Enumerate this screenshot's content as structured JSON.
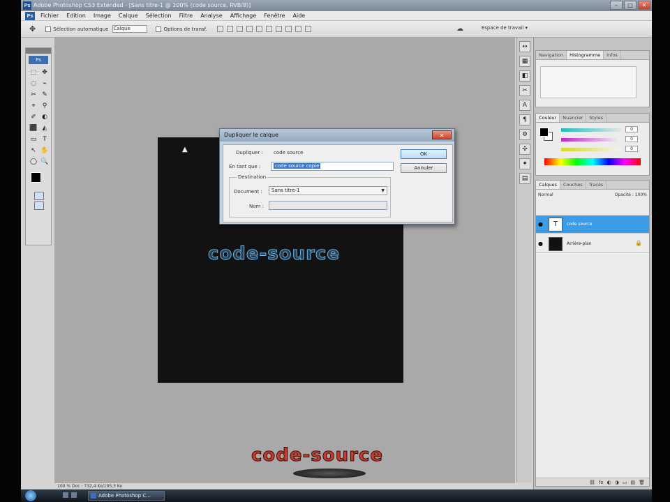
{
  "window": {
    "title": "Adobe Photoshop CS3 Extended - [Sans titre-1 @ 100% (code source, RVB/8)]",
    "app_icon": "Ps",
    "controls": [
      "–",
      "□",
      "✕"
    ]
  },
  "menu": {
    "items": [
      "Fichier",
      "Edition",
      "Image",
      "Calque",
      "Sélection",
      "Filtre",
      "Analyse",
      "Affichage",
      "Fenêtre",
      "Aide"
    ]
  },
  "options_bar": {
    "tool_icon": "move-tool-icon",
    "auto_select_label": "Sélection automatique",
    "auto_select_combo": "Calque",
    "transform_label": "Options de transf.",
    "workspace_label": "Espace de travail ▾"
  },
  "toolbox": {
    "badge": "Ps",
    "tools": [
      "⬚",
      "✥",
      "◌",
      "⌁",
      "✂",
      "✎",
      "⌖",
      "⚲",
      "✐",
      "◐",
      "⬛",
      "◭",
      "▭",
      "T",
      "↖",
      "✋",
      "◯",
      "🔍"
    ]
  },
  "document": {
    "text_layer_content": "code-source"
  },
  "watermark": {
    "text": "code-source"
  },
  "status_bar": {
    "text": "100 %      Doc : 732,4 Ko/195,3 Ko"
  },
  "dialog": {
    "title": "Dupliquer le calque",
    "close_label": "✕",
    "duplicate_label": "Dupliquer :",
    "duplicate_value": "code source",
    "as_label": "En tant que :",
    "as_value": "code source copie",
    "destination_label": "Destination",
    "document_label": "Document :",
    "document_value": "Sans titre-1",
    "name_label": "Nom :",
    "ok_label": "OK",
    "cancel_label": "Annuler"
  },
  "panels": {
    "navigator_tabs": [
      "Navigation",
      "Histogramme",
      "Infos"
    ],
    "color_tabs": [
      "Couleur",
      "Nuancier",
      "Styles"
    ],
    "color_values": {
      "r": "0",
      "g": "0",
      "b": "0"
    },
    "layers_tabs": [
      "Calques",
      "Couches",
      "Tracés"
    ],
    "layers_blend": "Normal",
    "layers_opacity": "Opacité : 100%",
    "layers": [
      {
        "name": "code source",
        "thumb": "T",
        "selected": true
      },
      {
        "name": "Arrière-plan",
        "thumb": "",
        "selected": false,
        "lock": "🔒"
      }
    ],
    "layers_footer_icons": [
      "⛓",
      "fx",
      "◐",
      "◑",
      "▭",
      "▤",
      "🗑"
    ]
  },
  "right_icons": [
    "↔",
    "▦",
    "◧",
    "✂",
    "A",
    "¶",
    "⚙",
    "✣",
    "✦",
    "▤"
  ],
  "taskbar": {
    "task_label": "Adobe Photoshop C..."
  },
  "colors": {
    "accent_selection": "#3b9de8",
    "doc_background": "#121212",
    "text_stroke": "#5fb6e8",
    "watermark": "#c43a2c"
  }
}
